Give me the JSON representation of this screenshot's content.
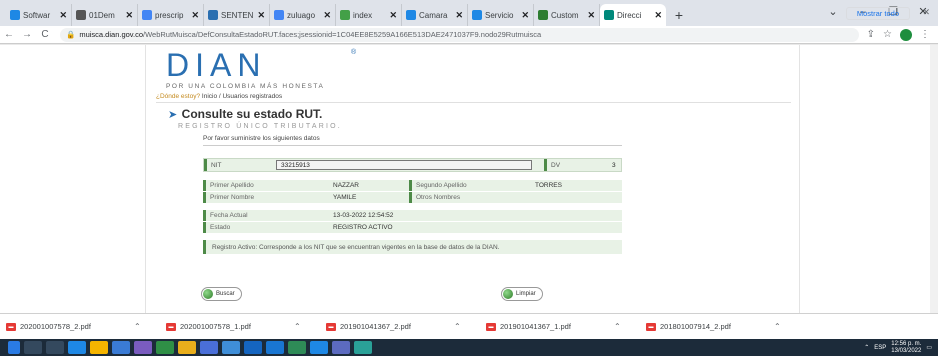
{
  "browser": {
    "tabs": [
      {
        "label": "Softwar",
        "color": "#1e88e5"
      },
      {
        "label": "01Dem",
        "color": "#555555"
      },
      {
        "label": "prescrip",
        "color": "#4285f4"
      },
      {
        "label": "SENTEN",
        "color": "#2a6fb1"
      },
      {
        "label": "zuluago",
        "color": "#4285f4"
      },
      {
        "label": "index",
        "color": "#43a047"
      },
      {
        "label": "Camara",
        "color": "#1e88e5"
      },
      {
        "label": "Servicio",
        "color": "#1e88e5"
      },
      {
        "label": "Custom",
        "color": "#2e7d32"
      },
      {
        "label": "Direcci",
        "color": "#00897b",
        "active": true
      }
    ],
    "new_tab": "+",
    "window_controls": [
      "⌄",
      "–",
      "❐",
      "✕"
    ],
    "url_host": "muisca.dian.gov.co",
    "url_path": "/WebRutMuisca/DefConsultaEstadoRUT.faces;jsessionid=1C04EE8E5259A166E513DAE2471037F9.nodo29Rutmuisca"
  },
  "page": {
    "logo_text": "DIAN",
    "logo_reg": "®",
    "slogan": "POR UNA COLOMBIA MÁS HONESTA",
    "crumb_where": "¿Dónde estoy?",
    "crumb_path": " Inicio / Usuarios registrados",
    "title": "Consulte su estado RUT.",
    "subtitle": "REGISTRO ÚNICO TRIBUTARIO.",
    "instructions": "Por favor suministre los siguientes datos",
    "nit_label": "NIT",
    "nit_value": "33215913",
    "dv_label": "DV",
    "dv_value": "3",
    "fields": {
      "primer_apellido_label": "Primer Apellido",
      "primer_apellido_value": "NAZZAR",
      "segundo_apellido_label": "Segundo Apellido",
      "segundo_apellido_value": "TORRES",
      "primer_nombre_label": "Primer Nombre",
      "primer_nombre_value": "YAMILE",
      "otros_nombres_label": "Otros Nombres",
      "otros_nombres_value": "",
      "fecha_label": "Fecha Actual",
      "fecha_value": "13-03-2022 12:54:52",
      "estado_label": "Estado",
      "estado_value": "REGISTRO ACTIVO"
    },
    "note": "Registro Activo: Corresponde a los NIT que se encuentran vigentes en la base de datos de la DIAN.",
    "buscar_label": "Buscar",
    "limpiar_label": "Limpiar"
  },
  "downloads": {
    "items": [
      "202001007578_2.pdf",
      "202001007578_1.pdf",
      "201901041367_2.pdf",
      "201901041367_1.pdf",
      "201801007914_2.pdf"
    ],
    "show_all": "Mostrar todo",
    "close": "✕"
  },
  "taskbar": {
    "lang": "ESP",
    "time": "12:56 p. m.",
    "date": "13/03/2022"
  }
}
